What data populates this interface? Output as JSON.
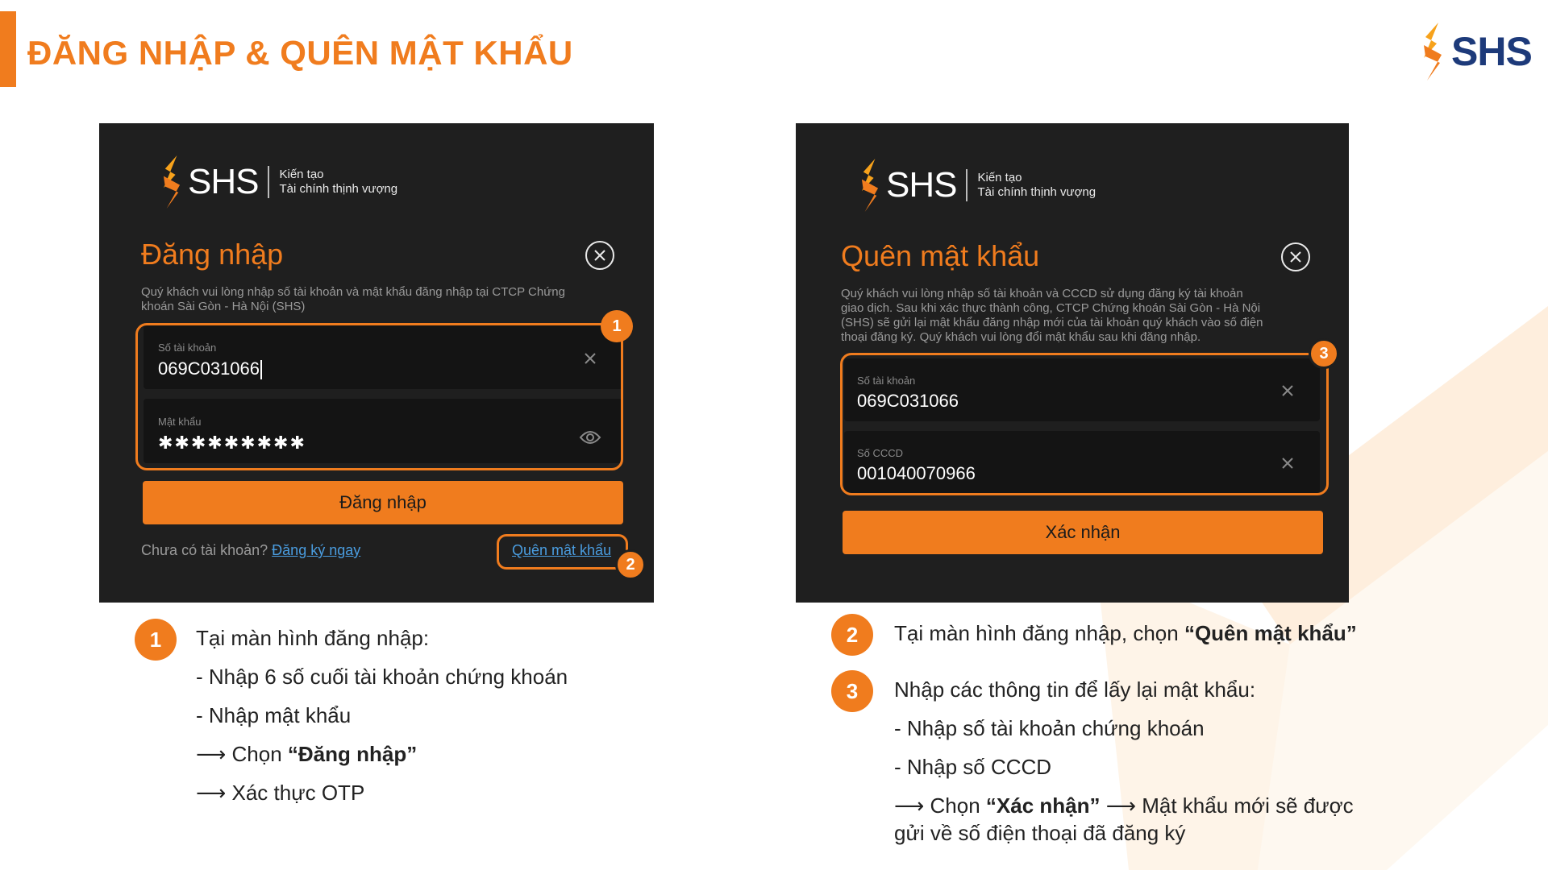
{
  "header": {
    "title": "ĐĂNG NHẬP & QUÊN MẬT KHẨU",
    "brand": "SHS"
  },
  "login_panel": {
    "logo_text": "SHS",
    "tagline_1": "Kiến tạo",
    "tagline_2": "Tài chính thịnh vượng",
    "title": "Đăng nhập",
    "description_1": "Quý khách vui lòng nhập số tài khoản và mật khẩu đăng nhập tại CTCP Chứng",
    "description_2": "khoán Sài Gòn - Hà Nội (SHS)",
    "account_label": "Số tài khoản",
    "account_value": "069C031066",
    "password_label": "Mật khẩu",
    "password_value": "✱✱✱✱✱✱✱✱✱",
    "login_button": "Đăng nhập",
    "no_account_text": "Chưa có tài khoản?",
    "register_link": "Đăng ký ngay",
    "forgot_link": "Quên mật khẩu",
    "badge_1": "1",
    "badge_2": "2"
  },
  "forgot_panel": {
    "logo_text": "SHS",
    "tagline_1": "Kiến tạo",
    "tagline_2": "Tài chính thịnh vượng",
    "title": "Quên mật khẩu",
    "description_1": "Quý khách vui lòng nhập số tài khoản và CCCD sử dụng đăng ký tài khoản",
    "description_2": "giao dịch. Sau khi xác thực thành công, CTCP Chứng khoán Sài Gòn - Hà Nội",
    "description_3": "(SHS) sẽ gửi lại mật khẩu đăng nhập mới của tài khoản quý khách vào số điện",
    "description_4": "thoại đăng ký. Quý khách vui lòng đổi mật khẩu sau khi đăng nhập.",
    "account_label": "Số tài khoản",
    "account_value": "069C031066",
    "id_label": "Số CCCD",
    "id_value": "001040070966",
    "confirm_button": "Xác nhận",
    "badge_3": "3"
  },
  "instructions_left": {
    "badge": "1",
    "line_1": "Tại màn hình đăng nhập:",
    "line_2": "- Nhập 6 số cuối tài khoản chứng khoán",
    "line_3": "- Nhập mật khẩu",
    "line_4_prefix": "⟶ Chọn ",
    "line_4_bold": "“Đăng nhập”",
    "line_5": "⟶ Xác thực OTP"
  },
  "instructions_right": {
    "badge_2": "2",
    "step2_prefix": "Tại màn hình đăng nhập, chọn ",
    "step2_bold": "“Quên mật khẩu”",
    "badge_3": "3",
    "step3_line_1": "Nhập các thông tin để lấy lại mật khẩu:",
    "step3_line_2": "- Nhập số tài khoản chứng khoán",
    "step3_line_3": "- Nhập số CCCD",
    "step3_line_4_prefix": "⟶ Chọn ",
    "step3_line_4_bold": "“Xác nhận”",
    "step3_line_4_suffix": " ⟶ Mật khẩu mới sẽ được",
    "step3_line_5": "gửi về số điện thoại đã đăng ký"
  },
  "colors": {
    "accent": "#f07c1e",
    "panel_bg": "#1f1f1f",
    "field_bg": "#141414",
    "brand_blue": "#1d3a7a",
    "link": "#4a9de0"
  }
}
